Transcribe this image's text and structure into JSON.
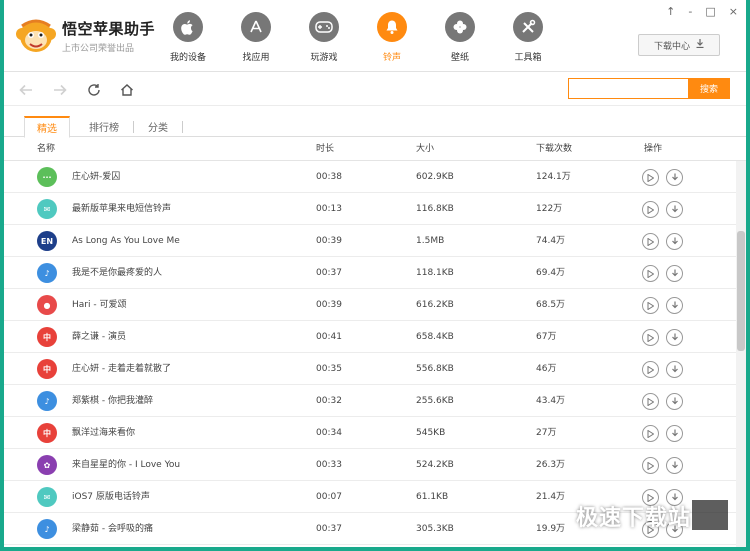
{
  "app": {
    "title": "悟空苹果助手",
    "subtitle": "上市公司荣誉出品"
  },
  "nav": [
    {
      "label": "我的设备",
      "icon": "apple-icon",
      "active": false
    },
    {
      "label": "找应用",
      "icon": "app-store-icon",
      "active": false
    },
    {
      "label": "玩游戏",
      "icon": "gamepad-icon",
      "active": false
    },
    {
      "label": "铃声",
      "icon": "bell-icon",
      "active": true
    },
    {
      "label": "壁纸",
      "icon": "clover-icon",
      "active": false
    },
    {
      "label": "工具箱",
      "icon": "tools-icon",
      "active": false
    }
  ],
  "window_controls": [
    "↑",
    "-",
    "□",
    "×"
  ],
  "download_center": "下载中心",
  "search": {
    "placeholder": "",
    "button": "搜索"
  },
  "tabs": [
    {
      "label": "精选",
      "active": true
    },
    {
      "label": "排行榜",
      "active": false
    },
    {
      "label": "分类",
      "active": false
    }
  ],
  "table": {
    "headers": {
      "name": "名称",
      "duration": "时长",
      "size": "大小",
      "downloads": "下载次数",
      "actions": "操作"
    },
    "rows": [
      {
        "name": "庄心妍-爱囚",
        "duration": "00:38",
        "size": "602.9KB",
        "downloads": "124.1万",
        "icon_color": "#5cbf5a",
        "icon_text": "···"
      },
      {
        "name": "最新版苹果来电短信铃声",
        "duration": "00:13",
        "size": "116.8KB",
        "downloads": "122万",
        "icon_color": "#4fc9c0",
        "icon_text": "✉"
      },
      {
        "name": "As Long As You Love Me",
        "duration": "00:39",
        "size": "1.5MB",
        "downloads": "74.4万",
        "icon_color": "#1e3f8a",
        "icon_text": "EN"
      },
      {
        "name": "我是不是你最疼爱的人",
        "duration": "00:37",
        "size": "118.1KB",
        "downloads": "69.4万",
        "icon_color": "#3d8fe0",
        "icon_text": "♪"
      },
      {
        "name": "Hari - 可爱颂",
        "duration": "00:39",
        "size": "616.2KB",
        "downloads": "68.5万",
        "icon_color": "#e84a4a",
        "icon_text": "●"
      },
      {
        "name": "薛之谦 - 演员",
        "duration": "00:41",
        "size": "658.4KB",
        "downloads": "67万",
        "icon_color": "#e8413a",
        "icon_text": "中"
      },
      {
        "name": "庄心妍 - 走着走着就散了",
        "duration": "00:35",
        "size": "556.8KB",
        "downloads": "46万",
        "icon_color": "#e8413a",
        "icon_text": "中"
      },
      {
        "name": "郑紫棋 - 你把我灌醉",
        "duration": "00:32",
        "size": "255.6KB",
        "downloads": "43.4万",
        "icon_color": "#3d8fe0",
        "icon_text": "♪"
      },
      {
        "name": "飘洋过海来看你",
        "duration": "00:34",
        "size": "545KB",
        "downloads": "27万",
        "icon_color": "#e8413a",
        "icon_text": "中"
      },
      {
        "name": "来自星星的你 - I Love You",
        "duration": "00:33",
        "size": "524.2KB",
        "downloads": "26.3万",
        "icon_color": "#8a3fb0",
        "icon_text": "✿"
      },
      {
        "name": "iOS7 原版电话铃声",
        "duration": "00:07",
        "size": "61.1KB",
        "downloads": "21.4万",
        "icon_color": "#4fc9c0",
        "icon_text": "✉"
      },
      {
        "name": "梁静茹 - 会呼吸的痛",
        "duration": "00:37",
        "size": "305.3KB",
        "downloads": "19.9万",
        "icon_color": "#3d8fe0",
        "icon_text": "♪"
      }
    ]
  },
  "watermark": "极速下载站",
  "colors": {
    "accent": "#ff8a10",
    "frame": "#19a98c"
  }
}
